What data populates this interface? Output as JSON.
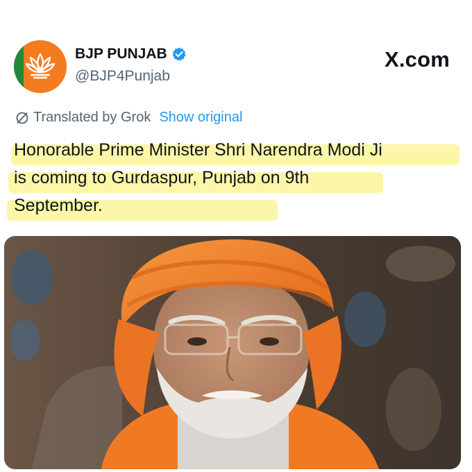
{
  "account": {
    "display_name": "BJP PUNJAB",
    "handle": "@BJP4Punjab",
    "avatar_icon": "lotus-logo-icon",
    "verified_icon": "verified-badge-icon",
    "verified_color": "#1d9bf0"
  },
  "site": {
    "brand": "X.com"
  },
  "translation": {
    "icon": "translate-icon",
    "translated_by": "Translated by Grok",
    "show_original": "Show original",
    "link_color": "#1d9bf0"
  },
  "tweet": {
    "lines": [
      "Honorable Prime Minister Shri Narendra Modi Ji",
      "is coming to Gurdaspur, Punjab on 9th",
      "September."
    ],
    "highlight_color": "#fbf6a8"
  },
  "media": {
    "icon": "photo-icon",
    "accent_color": "#f07a24"
  }
}
